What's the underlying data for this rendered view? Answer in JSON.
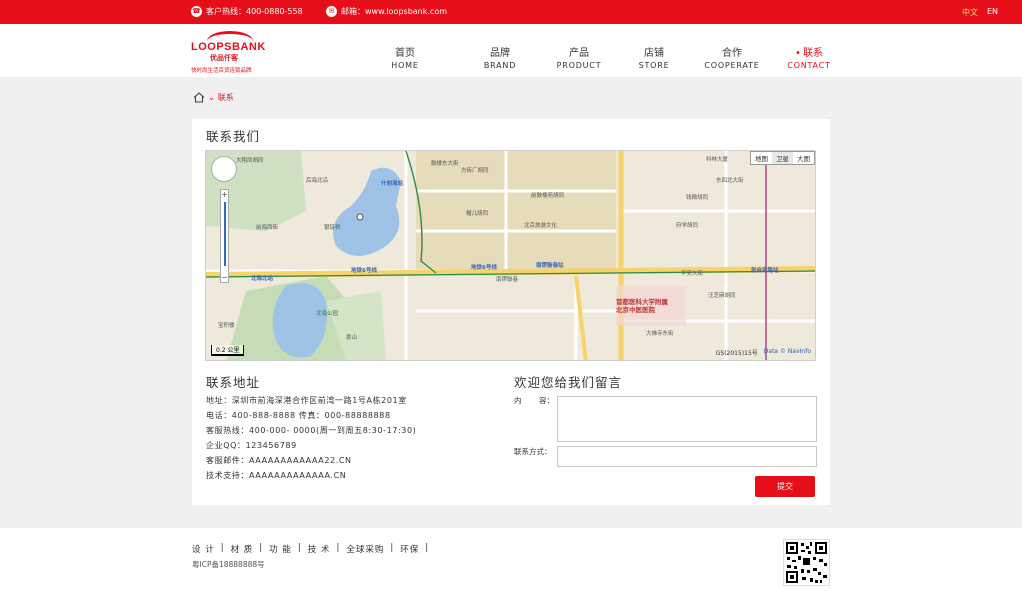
{
  "topbar": {
    "hotline": "客户热线：400-0880-558",
    "email": "邮箱：www.loopsbank.com",
    "lang_zh": "中文",
    "lang_en": "EN"
  },
  "logo": {
    "brand": "LOOPSBANK",
    "cn": "优品仟客",
    "slogan": "快时尚生活百货连锁品牌"
  },
  "nav": [
    {
      "cn": "首页",
      "en": "HOME"
    },
    {
      "cn": "品牌",
      "en": "BRAND"
    },
    {
      "cn": "产品",
      "en": "PRODUCT"
    },
    {
      "cn": "店铺",
      "en": "STORE"
    },
    {
      "cn": "合作",
      "en": "COOPERATE"
    },
    {
      "cn": "联系",
      "en": "CONTACT"
    }
  ],
  "breadcrumb": {
    "current": "联系"
  },
  "page_title": "联系我们",
  "map": {
    "maptype_map": "地图",
    "maptype_sat": "卫星",
    "maptype_big": "大图",
    "scale": "0.2 公里",
    "gs": "GS(2015)15号",
    "data": "Data © NavInfo",
    "labels": {
      "l1": "什刹海站",
      "l2": "北海北站",
      "l3": "南锣鼓巷站",
      "l4": "张自忠路站",
      "l5": "首都医科大学附属",
      "l6": "北京中医医院",
      "l7": "地铁6号线",
      "l8": "地铁6号线",
      "l9": "南锣鼓巷",
      "l10": "大翔凤胡同",
      "l11": "前海西街",
      "l12": "后海北沿",
      "l13": "鼓楼东大街",
      "l14": "方砖厂胡同",
      "l15": "帽儿胡同",
      "l16": "北京旅游文化",
      "l17": "东四北大街",
      "l18": "科林大厦",
      "l19": "钱粮胡同",
      "l20": "北海公园",
      "l21": "景山",
      "l22": "宝积楼",
      "l23": "银锭桥",
      "l24": "平安大街",
      "l25": "交道口南大街",
      "l26": "府学胡同",
      "l27": "美术馆后街",
      "l28": "汪芝麻胡同",
      "l29": "大佛寺东街",
      "l30": "前鼓楼苑胡同"
    }
  },
  "contact": {
    "title": "联系地址",
    "lines": [
      "地址：深圳市前海深港合作区前湾一路1号A栋201室",
      "电话：400-888-8888    传真：000-88888888",
      "客服热线：400-000- 0000(周一到周五8:30-17:30)",
      "企业QQ：123456789",
      "客服邮件：AAAAAAAAAAAA22.CN",
      "技术支持：AAAAAAAAAAAAA.CN"
    ]
  },
  "message": {
    "title": "欢迎您给我们留言",
    "content_label_a": "内",
    "content_label_b": "容：",
    "contact_label": "联系方式：",
    "submit": "提交"
  },
  "footer": {
    "links": [
      "设 计",
      "材 质",
      "功 能",
      "技 术",
      "全球采购",
      "环保"
    ],
    "icp": "粤ICP备18888888号"
  },
  "colors": {
    "brand_red": "#e60e18"
  }
}
